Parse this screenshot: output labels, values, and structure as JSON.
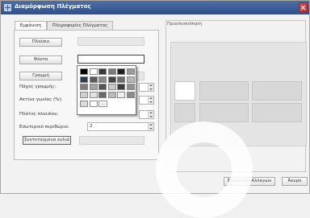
{
  "window": {
    "title": "Διαμόρφωση Πλέγματος",
    "icon": "grid-icon",
    "close_icon": "close-icon"
  },
  "tabs": [
    {
      "label": "Εμφάνιση",
      "active": true
    },
    {
      "label": "Πληροφορίες Πλέγματος",
      "active": false
    }
  ],
  "appearance": {
    "frame_button": "Πλαίσιο",
    "background_button": "Φόντο",
    "line_button": "Γραμμή",
    "line_width_label": "Πάχος γραμμής:",
    "corner_radius_label": "Ακτίνα γωνίας (%):",
    "frame_width_label": "Πλάτος πλαισίου:",
    "inner_padding_label": "Εσωτερικό περιθώριο:",
    "inner_padding_value": "2",
    "coordinates_button": "Συντεταγμένα κελιά"
  },
  "palette": {
    "rows": [
      [
        "#000000",
        "#ffffff",
        "#3a3a3a",
        "#7a7a7a",
        "#1f1f1f",
        "#9a9a9a"
      ],
      [
        "#2d3c52",
        "#5a5a5a",
        "#888888",
        "#444444",
        "#6d6d6d",
        "#b5b5b5"
      ],
      [
        "#7d7d7d",
        "#a2a2a2",
        "#555555",
        "#c8c8c8",
        "#3d3d3d",
        "#909090"
      ],
      [
        "#cfcfcf",
        "#e2e2e2",
        "#6a6a6a",
        "#bababa",
        "#f0f0f0",
        "#8c8c8c"
      ]
    ],
    "recent": [
      "#dcdcdc",
      "#ffffff"
    ],
    "more_label": "..."
  },
  "preview": {
    "label": "Προεπισκόπηση"
  },
  "footer": {
    "apply_button": "Εφαρμογή Αλλαγών",
    "cancel_button": "Άκυρο"
  }
}
